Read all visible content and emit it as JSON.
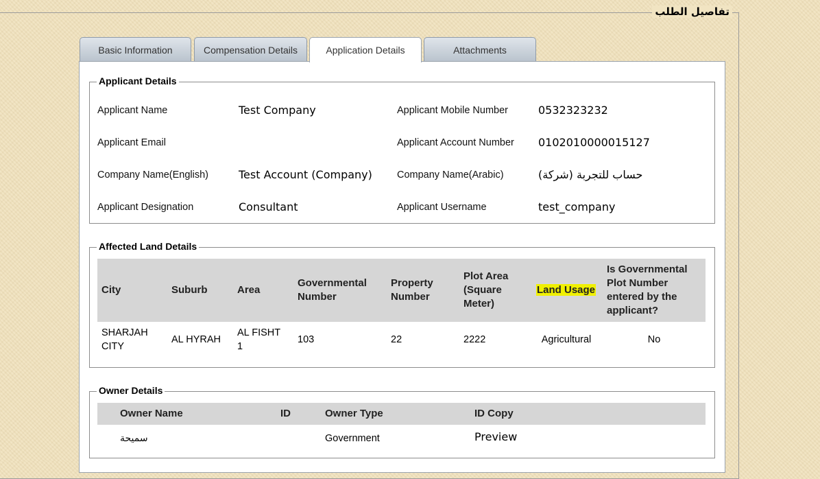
{
  "page": {
    "section_title": "تفاصيل الطلب"
  },
  "tabs": [
    {
      "label": "Basic Information",
      "active": false
    },
    {
      "label": "Compensation Details",
      "active": false
    },
    {
      "label": "Application Details",
      "active": true
    },
    {
      "label": "Attachments",
      "active": false
    }
  ],
  "applicant": {
    "legend": "Applicant Details",
    "fields": [
      {
        "label": "Applicant Name",
        "value": "Test Company"
      },
      {
        "label": "Applicant Mobile Number",
        "value": "0532323232"
      },
      {
        "label": "Applicant Email",
        "value": ""
      },
      {
        "label": "Applicant Account Number",
        "value": "0102010000015127"
      },
      {
        "label": "Company Name(English)",
        "value": "Test Account (Company)"
      },
      {
        "label": "Company Name(Arabic)",
        "value": "حساب للتجربة (شركة)"
      },
      {
        "label": "Applicant Designation",
        "value": "Consultant"
      },
      {
        "label": "Applicant Username",
        "value": "test_company"
      }
    ]
  },
  "land": {
    "legend": "Affected Land Details",
    "headers": [
      "City",
      "Suburb",
      "Area",
      "Governmental Number",
      "Property Number",
      "Plot Area (Square Meter)",
      "Land Usage",
      "Is Governmental Plot Number entered by the applicant?"
    ],
    "row": [
      "SHARJAH CITY",
      "AL HYRAH",
      "AL FISHT 1",
      "103",
      "22",
      "2222",
      "Agricultural",
      "No"
    ],
    "highlight_color": "#f0f000"
  },
  "owner": {
    "legend": "Owner Details",
    "headers": [
      "Owner Name",
      "ID",
      "Owner Type",
      "ID Copy"
    ],
    "row": {
      "name": "سميحة",
      "id": "",
      "type": "Government",
      "copy": "Preview"
    }
  }
}
